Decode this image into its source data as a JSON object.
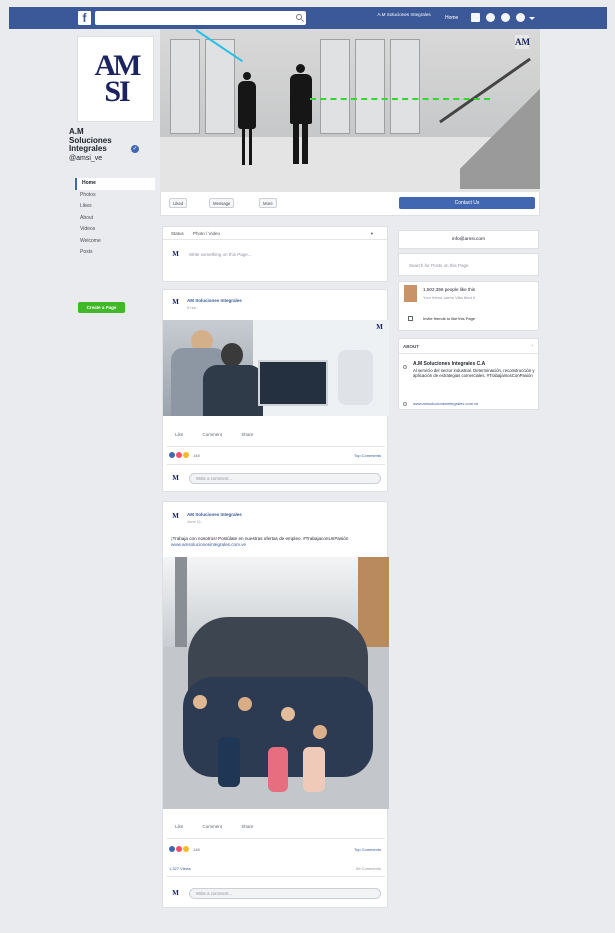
{
  "topbar": {
    "logo": "f",
    "user_name": "A.M Soluciones Integrales",
    "home": "Home"
  },
  "profile": {
    "name": "A.M Soluciones Integrales",
    "handle": "@amsi_ve",
    "logo_line1": "AM",
    "logo_line2": "SI"
  },
  "left_nav": {
    "items": [
      "Home",
      "Photos",
      "Likes",
      "About",
      "Videos",
      "Welcome",
      "Posts"
    ],
    "create_page": "Create a Page"
  },
  "action_bar": {
    "like": "Liked",
    "message": "Message",
    "more": "More",
    "contact": "Contact Us"
  },
  "composer": {
    "tab_status": "Status",
    "tab_photo": "Photo / Video",
    "placeholder": "Write something on this Page..."
  },
  "post1": {
    "author": "AM Soluciones Integrales",
    "meta": "5 hrs · ",
    "actions": [
      "Like",
      "Comment",
      "Share"
    ],
    "reaction_count": "148",
    "top_comments": "Top Comments",
    "comment_placeholder": "Write a comment..."
  },
  "post2": {
    "author": "AM Soluciones Integrales",
    "meta": "June 11 · ",
    "text": "¡Trabaja con nosotros! Postúlate en nuestras ofertas de empleo. #TrabajaconUnPasión ",
    "link": "www.amsolucionesintegrales.com.ve",
    "actions": [
      "Like",
      "Comment",
      "Share"
    ],
    "reaction_count": "148",
    "top_comments": "Top Comments",
    "views": "1,327 Views",
    "shares": "86 Comments",
    "comment_placeholder": "Write a comment..."
  },
  "right": {
    "email": "info@amsi.com",
    "search_posts": "Search for Posts on this Page",
    "likes_text": "1,502,356 people like this",
    "likes_sub": "Your friend Jaime Villa liked it",
    "invite": "Invite friends to like this Page",
    "about_title": "ABOUT",
    "about_name": "A.M Soluciones Integrales C.A",
    "about_desc": "Al servicio del sector industrial. Determinación, reconstrucción y aplicación de estrategias comerciales. #TrabajamosConPasión",
    "about_link": "www.amsolucionesintegrales.com.ve"
  },
  "colors": {
    "brand": "#3b5998",
    "button_blue": "#4267b2",
    "create_green": "#42b72a",
    "logo_navy": "#1b2461"
  }
}
